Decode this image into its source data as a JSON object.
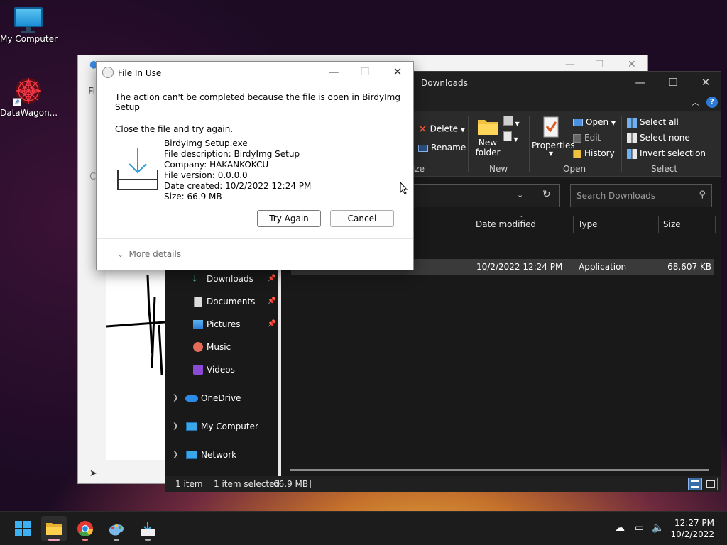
{
  "desktop": {
    "icons": [
      {
        "label": "My Computer",
        "icon": "monitor-icon"
      },
      {
        "label": "DataWagon...",
        "icon": "mandala-icon"
      }
    ]
  },
  "bg_window": {
    "menu_text": "Fi",
    "side_text": "Cl"
  },
  "explorer": {
    "title": "Downloads",
    "ribbon": {
      "delete": "Delete",
      "rename": "Rename",
      "new_folder_line1": "New",
      "new_folder_line2": "folder",
      "properties": "Properties",
      "open": "Open",
      "edit": "Edit",
      "history": "History",
      "select_all": "Select all",
      "select_none": "Select none",
      "invert_selection": "Invert selection",
      "group_organize_partial": "ize",
      "group_new": "New",
      "group_open": "Open",
      "group_select": "Select"
    },
    "search_placeholder": "Search Downloads",
    "columns": {
      "date_modified": "Date modified",
      "type": "Type",
      "size": "Size"
    },
    "file": {
      "date": "10/2/2022 12:24 PM",
      "type": "Application",
      "size": "68,607 KB"
    },
    "nav": [
      {
        "label": "Downloads",
        "pinned": true,
        "icon": "download-arrow-icon"
      },
      {
        "label": "Documents",
        "pinned": true,
        "icon": "document-icon"
      },
      {
        "label": "Pictures",
        "pinned": true,
        "icon": "picture-icon"
      },
      {
        "label": "Music",
        "pinned": false,
        "icon": "music-icon"
      },
      {
        "label": "Videos",
        "pinned": false,
        "icon": "video-icon"
      },
      {
        "label": "OneDrive",
        "pinned": false,
        "icon": "cloud-icon"
      },
      {
        "label": "My Computer",
        "pinned": false,
        "icon": "monitor-icon"
      },
      {
        "label": "Network",
        "pinned": false,
        "icon": "network-icon"
      }
    ],
    "status": {
      "items": "1 item",
      "selected": "1 item selected",
      "size": "66.9 MB"
    }
  },
  "dialog": {
    "title": "File In Use",
    "message": "The action can't be completed because the file is open in BirdyImg Setup",
    "instruction": "Close the file and try again.",
    "file_name": "BirdyImg Setup.exe",
    "description": "File description: BirdyImg Setup",
    "company": "Company: HAKANKOKCU",
    "version": "File version: 0.0.0.0",
    "date_created": "Date created: 10/2/2022 12:24 PM",
    "size": "Size: 66.9 MB",
    "try_again": "Try Again",
    "cancel": "Cancel",
    "more_details": "More details"
  },
  "taskbar": {
    "time": "12:27 PM",
    "date": "10/2/2022",
    "apps": [
      "start-icon",
      "file-explorer-icon",
      "chrome-icon",
      "paint-icon",
      "installer-icon"
    ]
  }
}
